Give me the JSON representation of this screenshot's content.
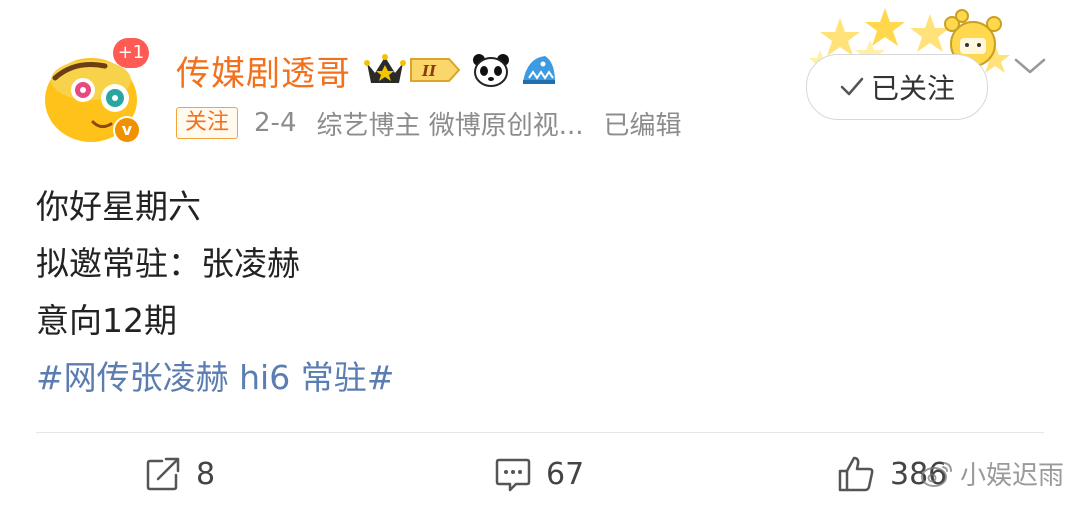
{
  "post": {
    "author": {
      "name": "传媒剧透哥",
      "avatar_badge": "+1",
      "verified_badge": "v",
      "level_badge": "II"
    },
    "meta": {
      "follow_tag": "关注",
      "date": "2-4",
      "source": "综艺博主 微博原创视...",
      "edited": "已编辑"
    },
    "follow_button": {
      "label": "已关注"
    },
    "content": {
      "lines": [
        "你好星期六",
        "拟邀常驻：张凌赫",
        "意向12期"
      ],
      "hashtag": "#网传张凌赫 hi6 常驻#"
    },
    "actions": {
      "repost_count": "8",
      "comment_count": "67",
      "like_count": "386"
    },
    "watermark": {
      "text": "小娱迟雨"
    }
  },
  "colors": {
    "username": "#f2711c",
    "hashtag": "#5b7db1",
    "verified": "#f29100",
    "badge": "#ff5a53"
  }
}
